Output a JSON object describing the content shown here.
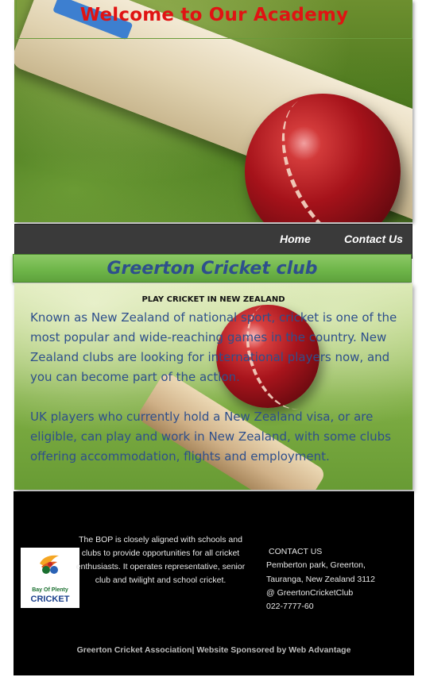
{
  "hero": {
    "title": "Welcome to Our Academy"
  },
  "nav": {
    "items": [
      {
        "label": "Home"
      },
      {
        "label": "Contact Us"
      }
    ]
  },
  "club": {
    "name": "Greerton Cricket club"
  },
  "content": {
    "label": "PLAY CRICKET IN NEW ZEALAND",
    "paragraph1": "Known as New Zealand of national sport, cricket is one of the most popular and wide-reaching games in the country. New Zealand clubs are looking for international players now, and you can become part of the action.",
    "paragraph2": "UK players who currently hold a New Zealand visa, or are eligible, can play and work in New Zealand, with some clubs offering accommodation, flights and employment."
  },
  "footer": {
    "logo": {
      "line1": "Bay Of Plenty",
      "line2": "CRICKET"
    },
    "about": "The BOP is closely aligned with schools and clubs to provide opportunities for all cricket enthusiasts. It operates representative, senior club and twilight and school cricket.",
    "contact": {
      "heading": "CONTACT US",
      "address1": "Pemberton park, Greerton,",
      "address2": "Tauranga, New Zealand 3112",
      "social": "@ GreertonCricketClub",
      "phone": "022-7777-60"
    },
    "copyright": "Greerton Cricket Association| Website Sponsored by Web Advantage"
  },
  "colors": {
    "title_red": "#e01313",
    "heading_blue": "#2e4f8c",
    "nav_bg": "#3a3a3a",
    "banner_green": "#6fb64a",
    "footer_bg": "#000000"
  }
}
